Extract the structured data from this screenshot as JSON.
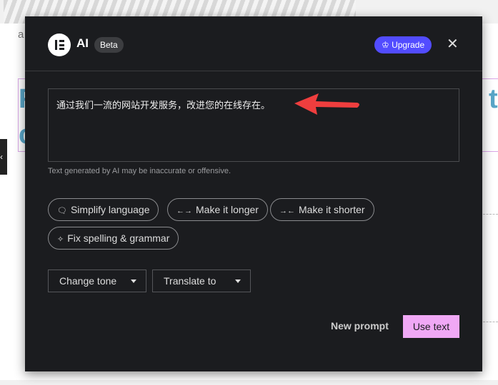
{
  "background": {
    "letter": "a",
    "heading_start": "F",
    "heading_line2": "c",
    "heading_end": "t",
    "side_tab_icon": "chevron-left-icon"
  },
  "dialog": {
    "title": "AI",
    "badge": "Beta",
    "upgrade_label": "Upgrade",
    "upgrade_icon": "crown-icon",
    "close_icon": "close-icon",
    "accent": "#524cff",
    "generated_text": "通过我们一流的网站开发服务，改进您的在线存在。",
    "disclaimer": "Text generated by AI may be inaccurate or offensive.",
    "actions": [
      {
        "label": "Simplify language",
        "icon": "speech-bubble-icon"
      },
      {
        "label": "Make it longer",
        "icon": "expand-arrows-icon"
      },
      {
        "label": "Make it shorter",
        "icon": "collapse-arrows-icon"
      },
      {
        "label": "Fix spelling & grammar",
        "icon": "sparkle-icon"
      }
    ],
    "selects": {
      "change_tone": "Change tone",
      "translate_to": "Translate to"
    },
    "new_prompt": "New prompt",
    "use_text": "Use text",
    "use_text_color": "#f0a8f5"
  }
}
